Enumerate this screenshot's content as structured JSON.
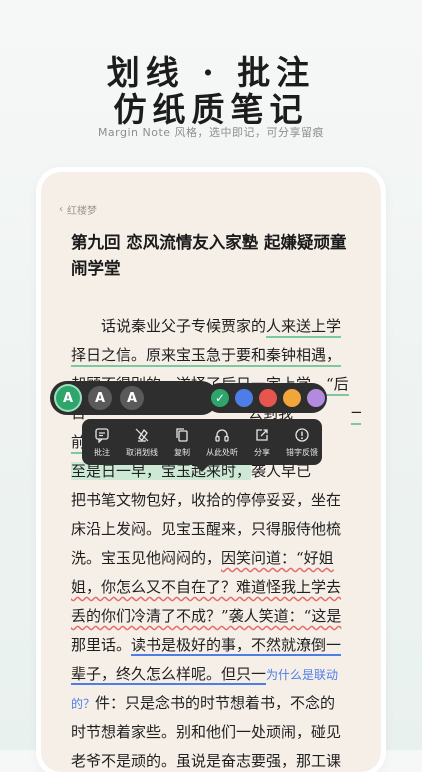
{
  "promo": {
    "title_line1": "划线 · 批注",
    "title_line2": "仿纸质笔记",
    "subtitle": "Margin Note 风格，选中即记，可分享留痕"
  },
  "reader": {
    "back_label": "红楼梦",
    "chapter_title_line1": "第九回 恋风流情友入家塾 起嫌疑顽童",
    "chapter_title_line2": "闹学堂",
    "lines": {
      "l1a": "　　话说秦业父子专候贾家的",
      "l1b": "人来送上学",
      "l2": "择日之信。原来宝玉急于要和秦钟相遇，",
      "l3": "却顾不得别的，遂择了后日一定上学。“后",
      "l4a": "日",
      "l4b": "公到我",
      "l4c": "一同",
      "l5": "前",
      "l6a": "至是日一早，宝玉起来时，",
      "l6b": "袭人早已",
      "l7": "把书笔文物包好，收拾的停停妥妥，坐在",
      "l8": "床沿上发闷。见宝玉醒来，只得服侍他梳",
      "l9a": "洗。宝玉见他闷闷的，",
      "l9b": "因笑问道：“好姐",
      "l10": "姐，你怎么又不自在了？难道怪我上学去",
      "l11": "丢的你们冷清了不成？”袭人笑道：“这是",
      "l12a": "那里话。",
      "l12b": "读书是极好的事，不然就潦倒一",
      "l13": "辈子，终久怎么样呢。但只一",
      "l13note": "为什么是联动",
      "l14note": "的？",
      "l14": "件：只是念书的时节想着书，不念的",
      "l15": "时节想着家些。别和他们一处顽闹，碰见",
      "l16": "老爷不是顽的。虽说是奋志要强，那工课"
    }
  },
  "style_bar": {
    "buttons": [
      "A",
      "A",
      "A"
    ]
  },
  "color_bar": {
    "colors": [
      "#2ea66b",
      "#4d7ee8",
      "#e8554e",
      "#f0a63a",
      "#b28be0"
    ]
  },
  "action_bar": {
    "items": [
      "批注",
      "取消划线",
      "复制",
      "从此处听",
      "分享",
      "错字反馈"
    ]
  }
}
